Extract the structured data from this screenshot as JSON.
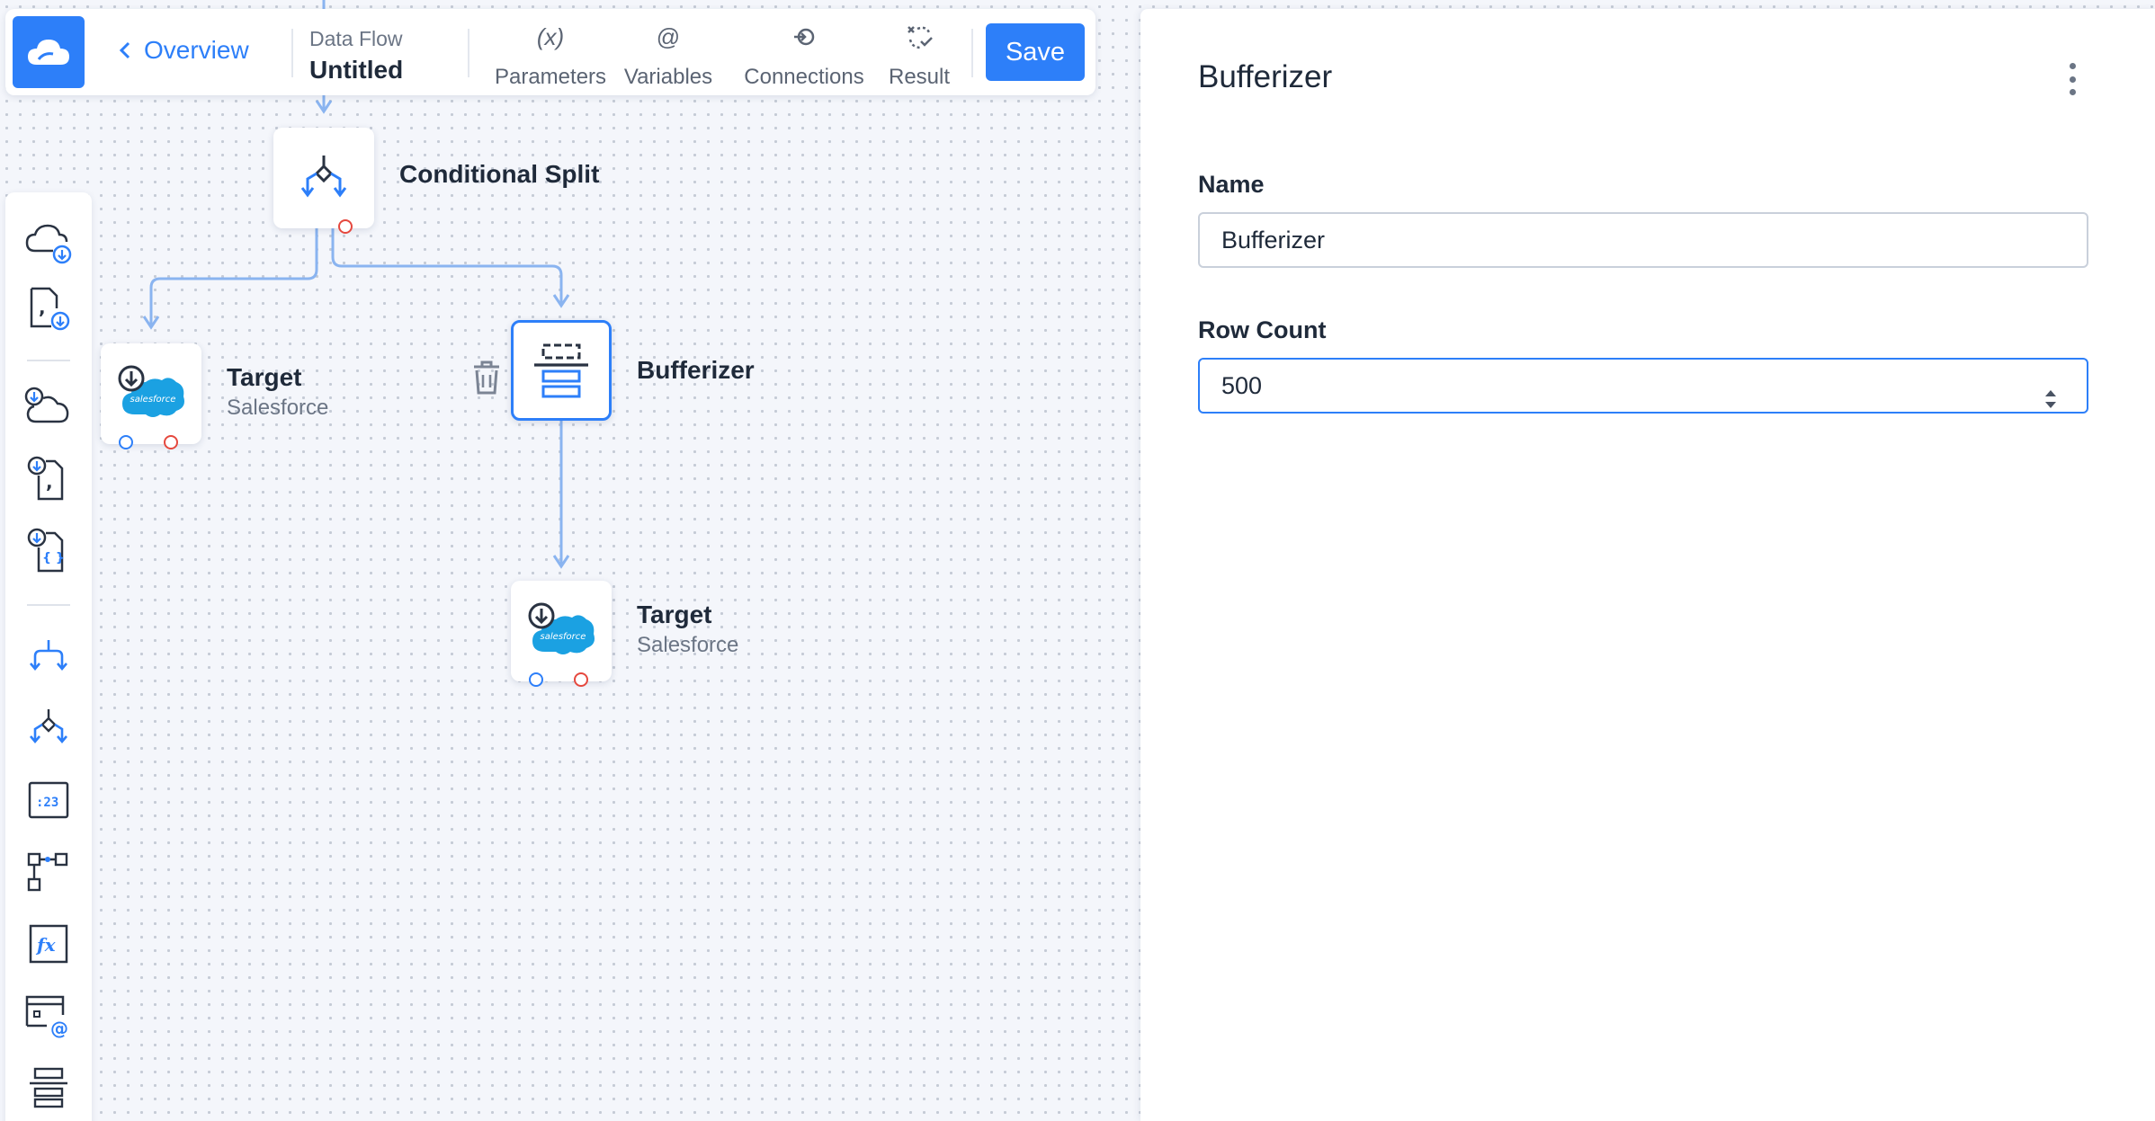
{
  "toolbar": {
    "back_label": "Overview",
    "flow_kind": "Data Flow",
    "flow_title": "Untitled",
    "tools": [
      {
        "icon": "parameters-icon",
        "glyph": "(x)",
        "label": "Parameters"
      },
      {
        "icon": "variables-icon",
        "glyph": "@",
        "label": "Variables"
      },
      {
        "icon": "connections-icon",
        "glyph": "",
        "label": "Connections"
      },
      {
        "icon": "result-icon",
        "glyph": "",
        "label": "Result"
      }
    ],
    "save_label": "Save"
  },
  "palette": {
    "items": [
      "cloud-source-icon",
      "csv-source-icon",
      "cloud-target-icon",
      "csv-target-icon",
      "json-target-icon",
      "split-icon",
      "conditional-split-icon",
      "value-icon",
      "lookup-icon",
      "expression-icon",
      "variable-icon",
      "bufferizer-icon"
    ]
  },
  "canvas": {
    "nodes": [
      {
        "id": "conditional-split",
        "title": "Conditional Split",
        "subtitle": ""
      },
      {
        "id": "target-left",
        "title": "Target",
        "subtitle": "Salesforce"
      },
      {
        "id": "bufferizer",
        "title": "Bufferizer",
        "subtitle": ""
      },
      {
        "id": "target-bottom",
        "title": "Target",
        "subtitle": "Salesforce"
      }
    ],
    "brand_text": "salesforce",
    "colors": {
      "accent": "#2d7ff9",
      "output_port": "#e5483e",
      "edge": "#8ab4f0",
      "salesforce": "#1ba1e2"
    }
  },
  "panel": {
    "title": "Bufferizer",
    "fields": {
      "name": {
        "label": "Name",
        "value": "Bufferizer"
      },
      "row_count": {
        "label": "Row Count",
        "value": "500"
      }
    }
  }
}
